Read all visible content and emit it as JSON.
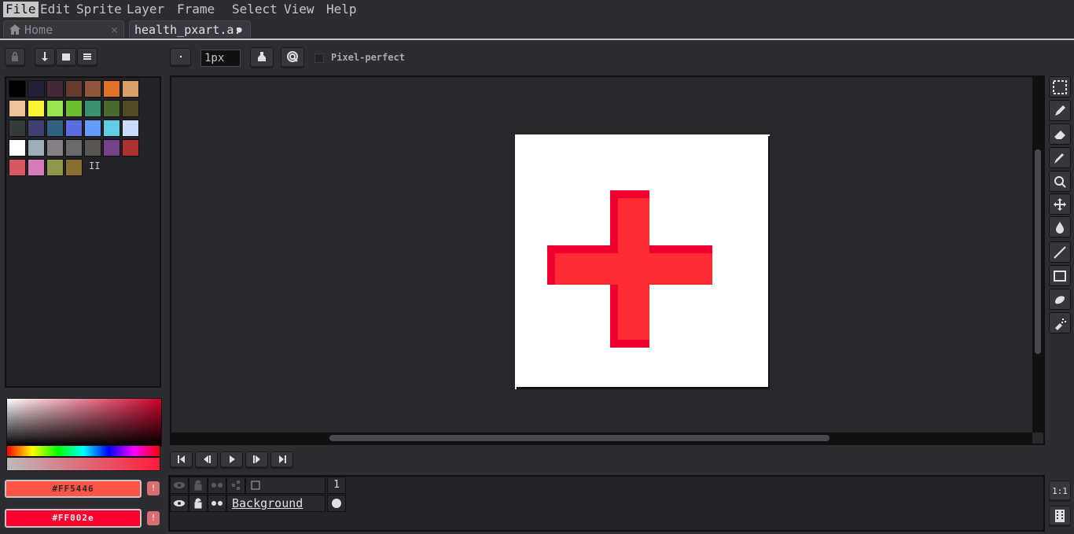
{
  "menu": {
    "items": [
      "File",
      "Edit",
      "Sprite",
      "Layer",
      "Frame",
      "Select",
      "View",
      "Help"
    ],
    "active": "File"
  },
  "tabs": [
    {
      "label": "Home",
      "close_glyph": "×"
    },
    {
      "label": "health_pxart.a:",
      "modified_glyph": "●"
    }
  ],
  "toolbar": {
    "brush_size": "1px",
    "pixel_perfect_label": "Pixel-perfect",
    "pixel_perfect_checked": false
  },
  "palette": {
    "colors": [
      "#000000",
      "#222034",
      "#45283c",
      "#663931",
      "#8f563b",
      "#df7126",
      "#d9a066",
      "#eec39a",
      "#fbf236",
      "#99e550",
      "#6abe30",
      "#37946e",
      "#4b692f",
      "#524b24",
      "#323c39",
      "#3f3f74",
      "#306082",
      "#5b6ee1",
      "#639bff",
      "#5fcde4",
      "#cbdbfc",
      "#ffffff",
      "#9badb7",
      "#847e87",
      "#696a6a",
      "#595652",
      "#76428a",
      "#ac3232",
      "#d95763",
      "#d77bba",
      "#8f974a",
      "#8a6f30"
    ],
    "end_marker": "II"
  },
  "colors": {
    "foreground": "#FF5446",
    "background": "#FF002e",
    "foreground_hex": "#ff5446",
    "background_hex": "#ff002e",
    "warning_glyph": "!"
  },
  "canvas": {
    "cross_primary": "#ff2b33",
    "cross_shadow": "#f0002c"
  },
  "timeline": {
    "frame_number": "1",
    "layer_name": "Background"
  },
  "status": {
    "zoom_button": "1:1"
  }
}
